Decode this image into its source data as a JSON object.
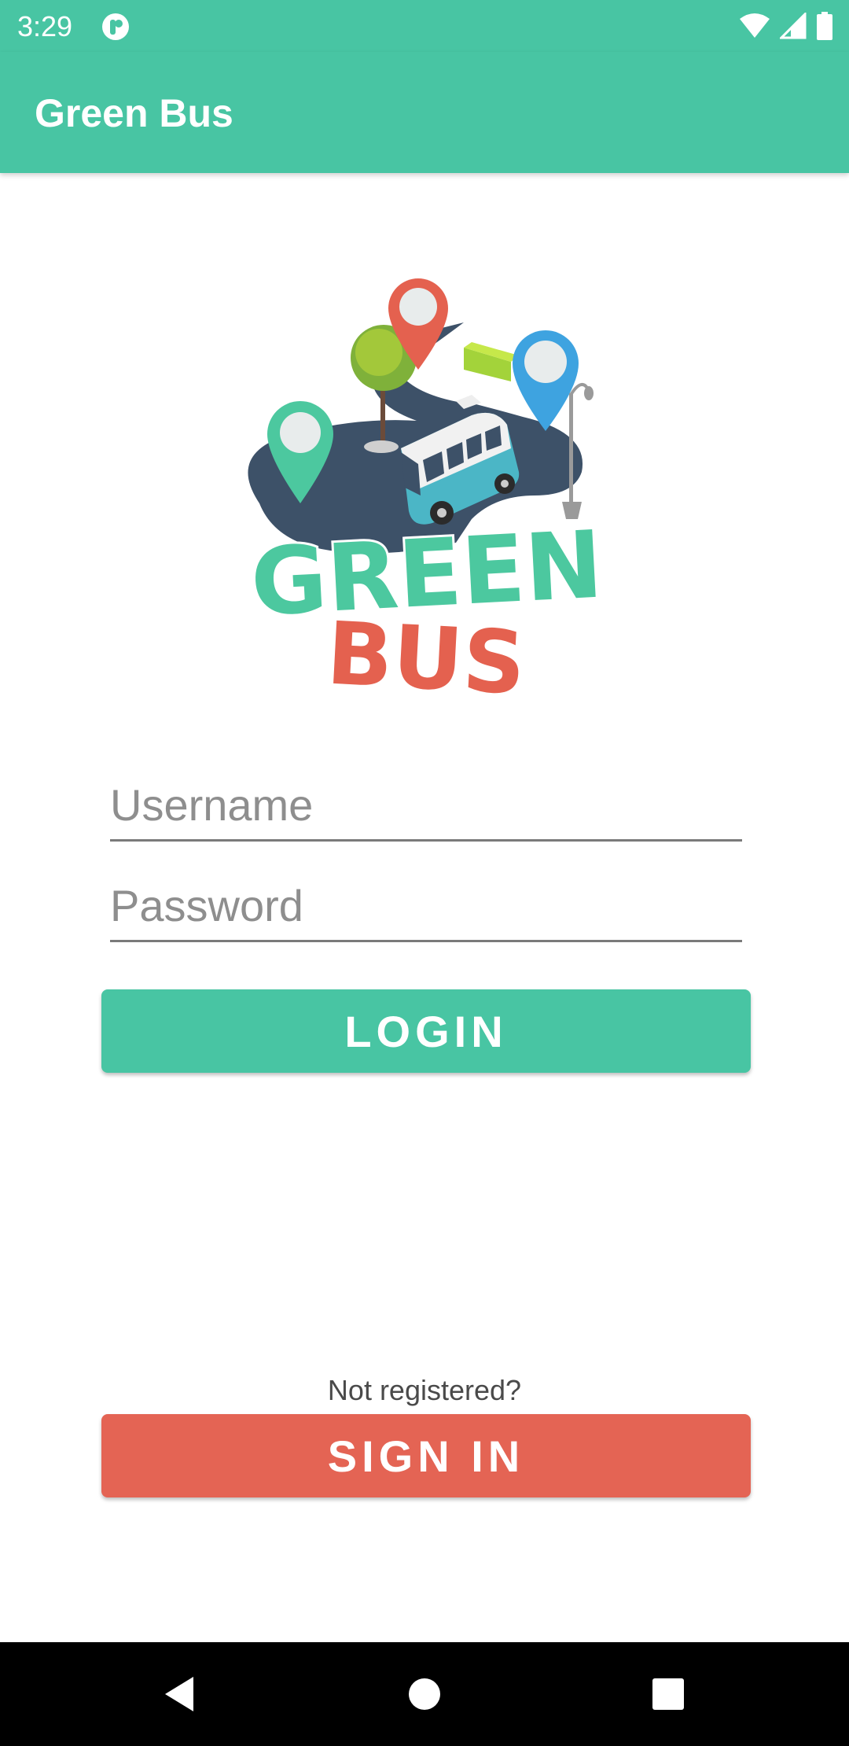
{
  "status_bar": {
    "time": "3:29",
    "app_icon": "notification-app-icon",
    "icons": [
      "wifi-icon",
      "signal-icon",
      "battery-icon"
    ]
  },
  "app_bar": {
    "title": "Green Bus"
  },
  "logo": {
    "line1": "GREEN",
    "line2": "BUS",
    "colors": {
      "green": "#4cc89f",
      "red": "#e4614f",
      "road": "#3d5168",
      "blue": "#3ea3e0"
    }
  },
  "form": {
    "username_placeholder": "Username",
    "username_value": "",
    "password_placeholder": "Password",
    "password_value": "",
    "login_label": "LOGIN"
  },
  "register": {
    "prompt": "Not registered?",
    "signin_label": "SIGN IN"
  },
  "nav_bar": {
    "icons": [
      "back-icon",
      "home-icon",
      "recents-icon"
    ]
  },
  "colors": {
    "primary": "#48c5a3",
    "accent": "#e46454",
    "nav": "#000000"
  }
}
